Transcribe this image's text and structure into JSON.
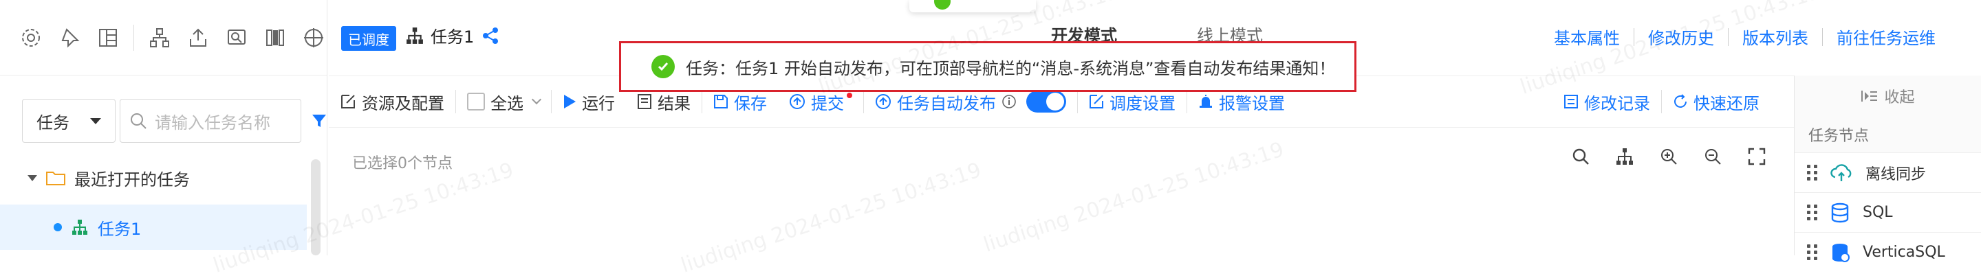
{
  "sidebar": {
    "toolbar_icons": [
      "gear-icon",
      "pin-icon",
      "layout-icon",
      "workflow-icon",
      "upload-icon",
      "image-search-icon",
      "book-icon",
      "target-icon"
    ],
    "filter": {
      "type_value": "任务",
      "search_placeholder": "请输入任务名称"
    },
    "tree": {
      "folder_label": "最近打开的任务",
      "task_label": "任务1"
    }
  },
  "header": {
    "badge": "已调度",
    "task_name": "任务1",
    "mode_dev": "开发模式",
    "mode_online": "线上模式",
    "links": [
      "基本属性",
      "修改历史",
      "版本列表",
      "前往任务运维"
    ]
  },
  "toolbar": {
    "resources": "资源及配置",
    "select_all": "全选",
    "run": "运行",
    "result": "结果",
    "save": "保存",
    "submit": "提交",
    "auto_publish": "任务自动发布",
    "schedule": "调度设置",
    "alarm": "报警设置",
    "change_log": "修改记录",
    "quick_restore": "快速还原"
  },
  "canvas": {
    "selected_count": "已选择0个节点"
  },
  "right_panel": {
    "collapse": "收起",
    "title": "任务节点",
    "nodes": [
      "离线同步",
      "SQL",
      "VerticaSQL"
    ]
  },
  "notification": {
    "message": "任务：任务1 开始自动发布，可在顶部导航栏的“消息-系统消息”查看自动发布结果通知！"
  },
  "watermark": "liudiqing 2024-01-25 10:43:19",
  "colors": {
    "primary": "#1677ff",
    "success": "#52c41a",
    "alert_border": "#d9232d"
  }
}
